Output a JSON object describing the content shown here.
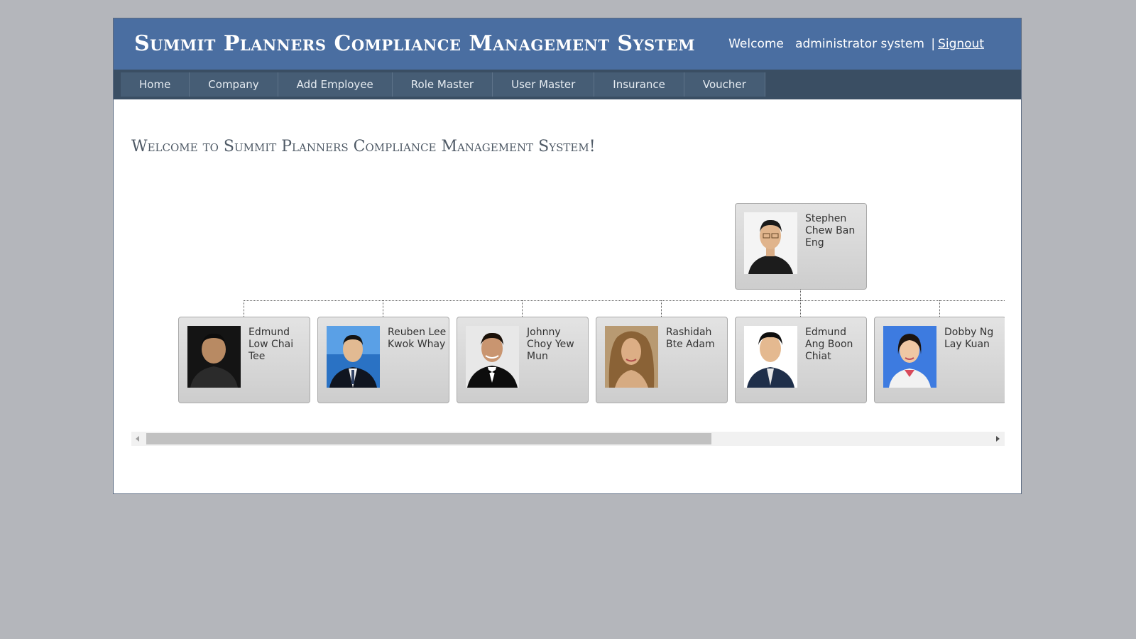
{
  "header": {
    "title": "Summit Planners Compliance Management System",
    "welcome_label": "Welcome",
    "user_name": "administrator system",
    "separator": "|",
    "signout_label": "Signout"
  },
  "nav": {
    "items": [
      "Home",
      "Company",
      "Add Employee",
      "Role Master",
      "User Master",
      "Insurance",
      "Voucher"
    ]
  },
  "main": {
    "heading": "Welcome to Summit Planners Compliance Management System!"
  },
  "org_chart": {
    "root": {
      "name": "Stephen Chew Ban Eng"
    },
    "children": [
      {
        "name": "Edmund Low Chai Tee"
      },
      {
        "name": "Reuben Lee Kwok Whay"
      },
      {
        "name": "Johnny Choy Yew Mun"
      },
      {
        "name": "Rashidah Bte Adam"
      },
      {
        "name": "Edmund Ang Boon Chiat"
      },
      {
        "name": "Dobby Ng Lay Kuan"
      }
    ]
  },
  "scrollbar": {
    "position_fraction": 0.0,
    "visible_fraction": 0.65
  },
  "colors": {
    "header_bg": "#4a6ea1",
    "nav_bg": "#3a4e63",
    "page_bg": "#b4b6bb",
    "heading_text": "#4f5a66"
  }
}
